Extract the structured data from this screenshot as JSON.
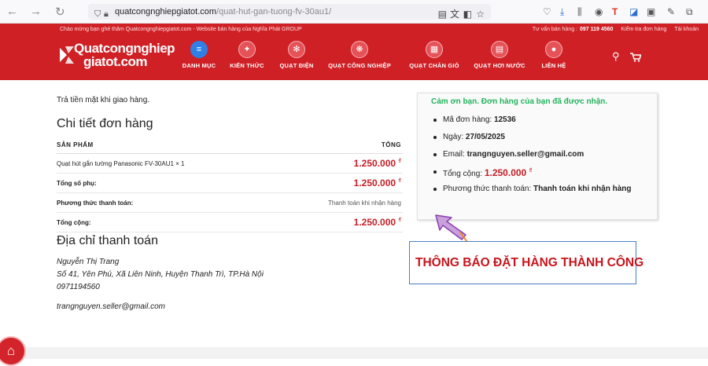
{
  "browser": {
    "url_host": "quatcongnghiepgiatot.com",
    "url_path": "/quat-hut-gan-tuong-fv-30au1/"
  },
  "header": {
    "welcome_text": "Chào mừng bạn ghé thăm Quatcongnghiepgiatot.com - Website bán hàng của Nghĩa Phát GROUP",
    "hotline_label": "Tư vấn bán hàng :",
    "hotline_number": "097 119 4560",
    "order_check_link": "Kiểm tra đơn hàng",
    "account_link": "Tài khoản",
    "logo_line1": "Quatcongnghiep",
    "logo_line2": "giatot.com",
    "menu": [
      {
        "label": "DANH MỤC",
        "icon": "menu-icon"
      },
      {
        "label": "KIẾN THỨC",
        "icon": "bulb-icon"
      },
      {
        "label": "QUẠT ĐIỆN",
        "icon": "fan-icon"
      },
      {
        "label": "QUẠT CÔNG NGHIỆP",
        "icon": "industrial-fan-icon"
      },
      {
        "label": "QUẠT CHẮN GIÓ",
        "icon": "air-curtain-icon"
      },
      {
        "label": "QUẠT HƠI NƯỚC",
        "icon": "cooler-icon"
      },
      {
        "label": "LIÊN HỆ",
        "icon": "location-pin-icon"
      }
    ]
  },
  "order": {
    "payment_note": "Trả tiền mặt khi giao hàng.",
    "details_heading": "Chi tiết đơn hàng",
    "col_product": "SẢN PHẨM",
    "col_total": "TỔNG",
    "rows": [
      {
        "label": "Quạt hút gắn tường Panasonic FV-30AU1 × 1",
        "value": "1.250.000",
        "currency": "₫"
      },
      {
        "label": "Tổng số phụ:",
        "value": "1.250.000",
        "currency": "₫"
      },
      {
        "label": "Phương thức thanh toán:",
        "value": "Thanh toán khi nhận hàng"
      },
      {
        "label": "Tổng cộng:",
        "value": "1.250.000",
        "currency": "₫"
      }
    ],
    "billing_heading": "Địa chỉ thanh toán",
    "billing_name": "Nguyễn Thị Trang",
    "billing_address": "Số 41, Yên Phú, Xã Liên Ninh, Huyện Thanh Trì, TP.Hà Nội",
    "billing_phone": "0971194560",
    "billing_email": "trangnguyen.seller@gmail.com"
  },
  "summary": {
    "thanks": "Cảm ơn bạn. Đơn hàng của bạn đã được nhận.",
    "order_no_label": "Mã đơn hàng:",
    "order_no": "12536",
    "date_label": "Ngày:",
    "date": "27/05/2025",
    "email_label": "Email:",
    "email": "trangnguyen.seller@gmail.com",
    "total_label": "Tổng cộng:",
    "total": "1.250.000",
    "currency": "₫",
    "method_label": "Phương thức thanh toán:",
    "method": "Thanh toán khi nhận hàng"
  },
  "annotation": {
    "notice": "THÔNG BÁO ĐẶT HÀNG THÀNH CÔNG"
  },
  "colors": {
    "brand_red": "#cf2026",
    "price_red": "#c41e25",
    "success_green": "#23b35d",
    "notice_border": "#4a7fc6"
  }
}
